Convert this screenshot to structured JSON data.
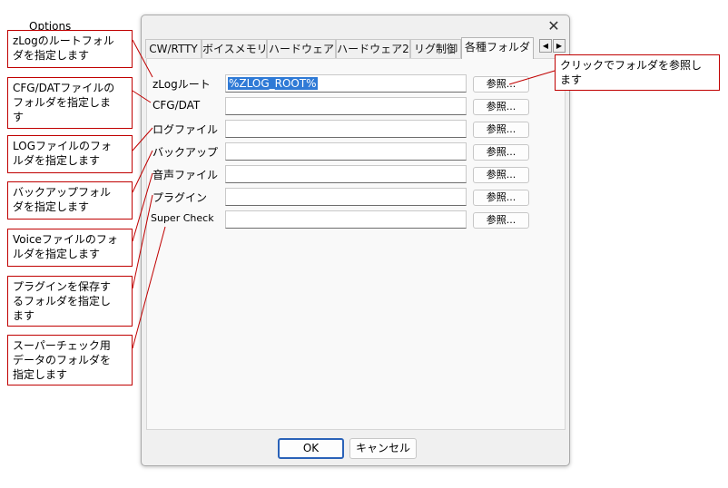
{
  "dialog": {
    "title": "Options",
    "close_glyph": "✕",
    "tabs": [
      {
        "label": "CW/RTTY"
      },
      {
        "label": "ボイスメモリ"
      },
      {
        "label": "ハードウェア"
      },
      {
        "label": "ハードウェア2"
      },
      {
        "label": "リグ制御"
      },
      {
        "label": "各種フォルダ",
        "active": true
      }
    ],
    "tab_scroll": {
      "left": "◀",
      "right": "▶"
    },
    "fields": [
      {
        "label": "zLogルート",
        "value": "%ZLOG_ROOT%",
        "button": "参照..."
      },
      {
        "label": "CFG/DAT",
        "value": "",
        "button": "参照..."
      },
      {
        "label": "ログファイル",
        "value": "",
        "button": "参照..."
      },
      {
        "label": "バックアップ",
        "value": "",
        "button": "参照..."
      },
      {
        "label": "音声ファイル",
        "value": "",
        "button": "参照..."
      },
      {
        "label": "プラグイン",
        "value": "",
        "button": "参照..."
      },
      {
        "label": "Super Check",
        "value": "",
        "button": "参照..."
      }
    ],
    "ok_label": "OK",
    "cancel_label": "キャンセル"
  },
  "annotations": {
    "zlog_root": [
      "zLogのルートフォル",
      "ダを指定します"
    ],
    "cfg_dat": [
      "CFG/DATファイルの",
      "フォルダを指定しま",
      "す"
    ],
    "log": [
      "LOGファイルのフォ",
      "ルダを指定します"
    ],
    "backup": [
      "バックアップフォル",
      "ダを指定します"
    ],
    "voice": [
      "Voiceファイルのフォ",
      "ルダを指定します"
    ],
    "plugin": [
      "プラグインを保存す",
      "るフォルダを指定し",
      "ます"
    ],
    "super_check": [
      "スーパーチェック用",
      "データのフォルダを",
      "指定します"
    ],
    "browse": [
      "クリックでフォルダを参照し",
      "ます"
    ]
  },
  "colors": {
    "callout_border": "#c00000",
    "selection": "#2f7ad6",
    "ok_border": "#2a62b8"
  }
}
